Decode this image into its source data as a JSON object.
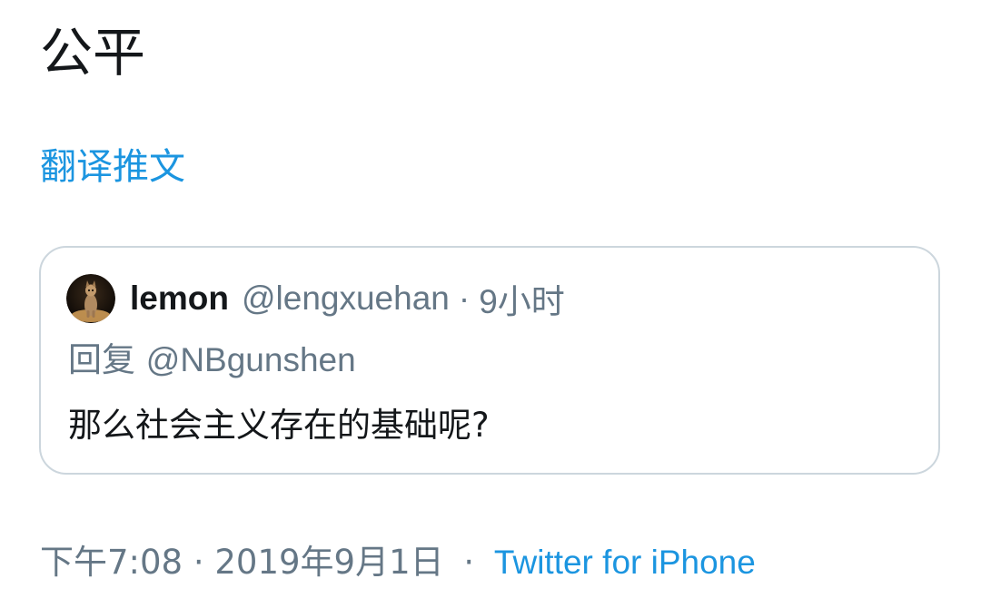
{
  "tweet": {
    "text": "公平",
    "translate_label": "翻译推文",
    "timestamp": "下午7:08 · 2019年9月1日",
    "separator": "·",
    "source": "Twitter for iPhone"
  },
  "quote": {
    "display_name": "lemon",
    "handle": "@lengxuehan",
    "separator": "·",
    "time": "9小时",
    "reply_prefix": "回复",
    "reply_to": "@NBgunshen",
    "text": "那么社会主义存在的基础呢?",
    "avatar_icon": "cat-avatar-icon"
  },
  "colors": {
    "link": "#1b95e0",
    "secondary_text": "#657786",
    "primary_text": "#14171a",
    "card_border": "#ccd6dd"
  }
}
